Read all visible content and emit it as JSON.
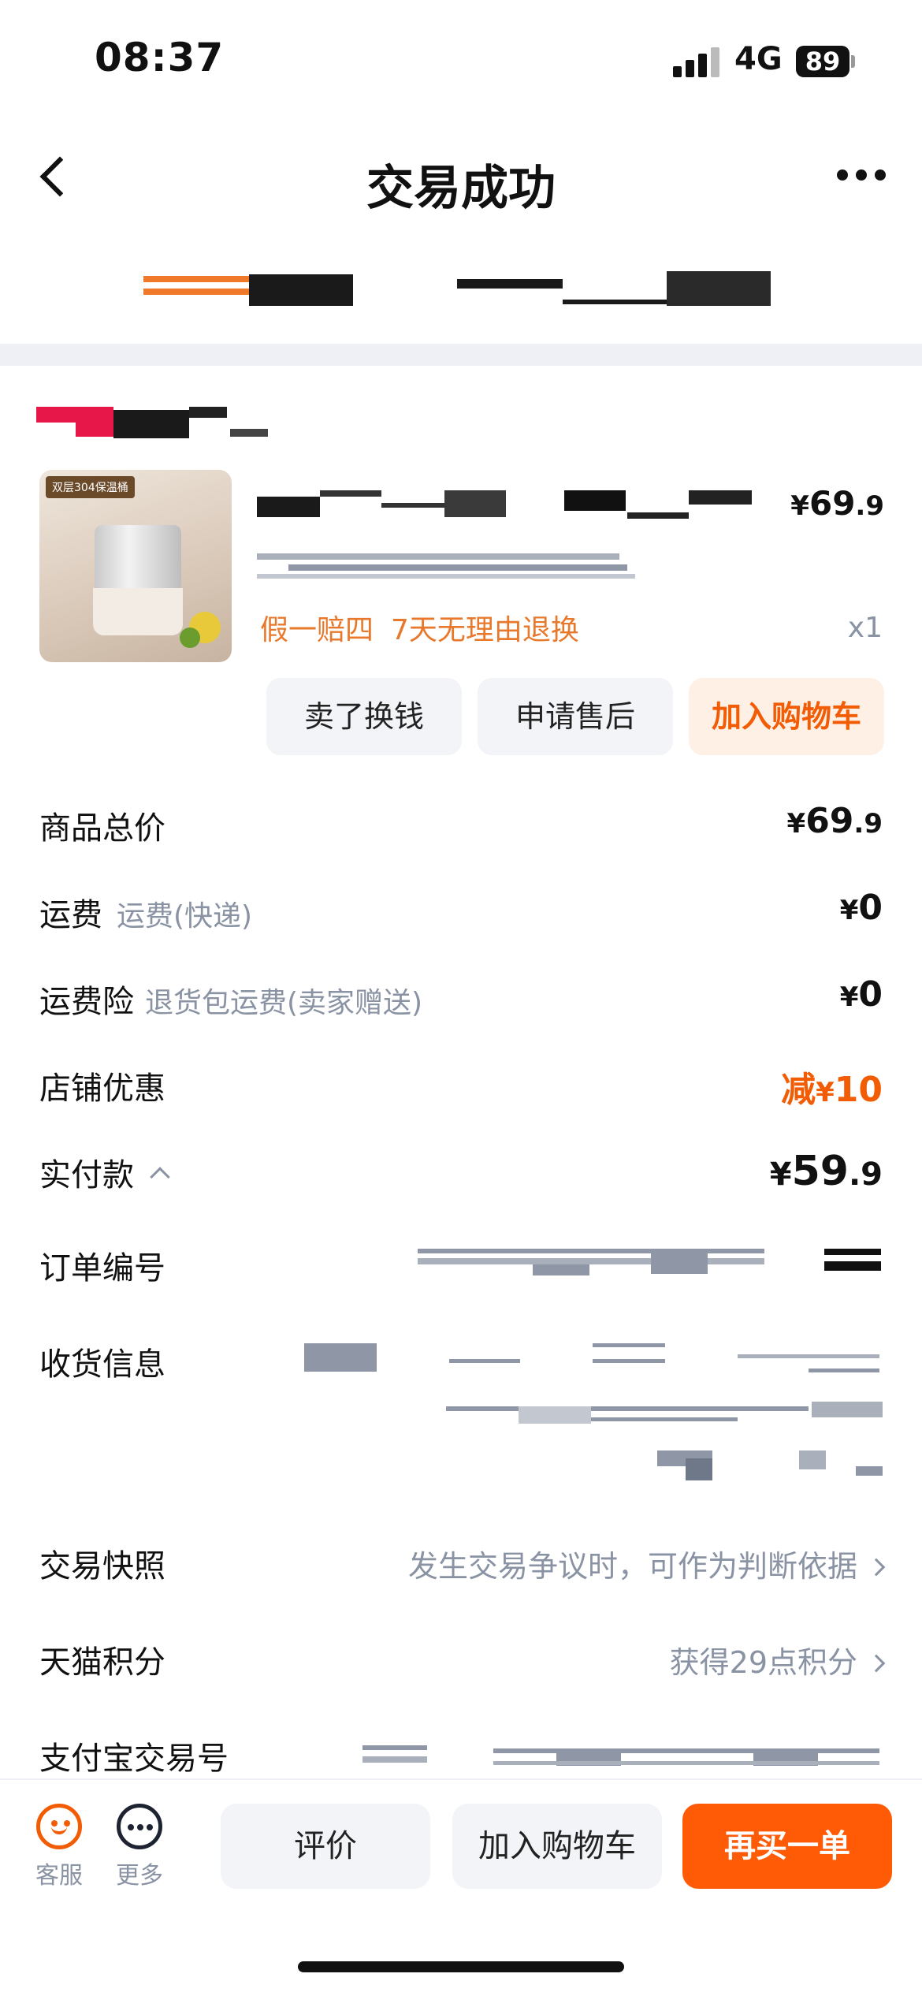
{
  "status": {
    "time": "08:37",
    "network": "4G",
    "battery": "89"
  },
  "nav": {
    "title": "交易成功"
  },
  "product": {
    "price_yen": "¥",
    "price_int": "69",
    "price_dec": ".9",
    "promise1": "假一赔四",
    "promise2": "7天无理由退换",
    "quantity": "x1",
    "image_tag": "双层304保温桶"
  },
  "actions": {
    "sell": "卖了换钱",
    "after_sale": "申请售后",
    "add_cart": "加入购物车"
  },
  "rows": {
    "total_label": "商品总价",
    "total_int": "69",
    "total_dec": ".9",
    "freight_label": "运费",
    "freight_sub": "运费(快递)",
    "freight_val": "0",
    "insurance_label": "运费险",
    "insurance_sub": "退货包运费(卖家赠送)",
    "insurance_val": "0",
    "discount_label": "店铺优惠",
    "discount_prefix": "减",
    "discount_val": "10",
    "paid_label": "实付款",
    "paid_int": "59",
    "paid_dec": ".9",
    "order_no_label": "订单编号",
    "address_label": "收货信息",
    "snapshot_label": "交易快照",
    "snapshot_val": "发生交易争议时，可作为判断依据",
    "points_label": "天猫积分",
    "points_val": "获得29点积分",
    "alipay_label": "支付宝交易号",
    "yen": "¥"
  },
  "bottom": {
    "service": "客服",
    "more": "更多",
    "review": "评价",
    "add_cart": "加入购物车",
    "rebuy": "再买一单"
  }
}
